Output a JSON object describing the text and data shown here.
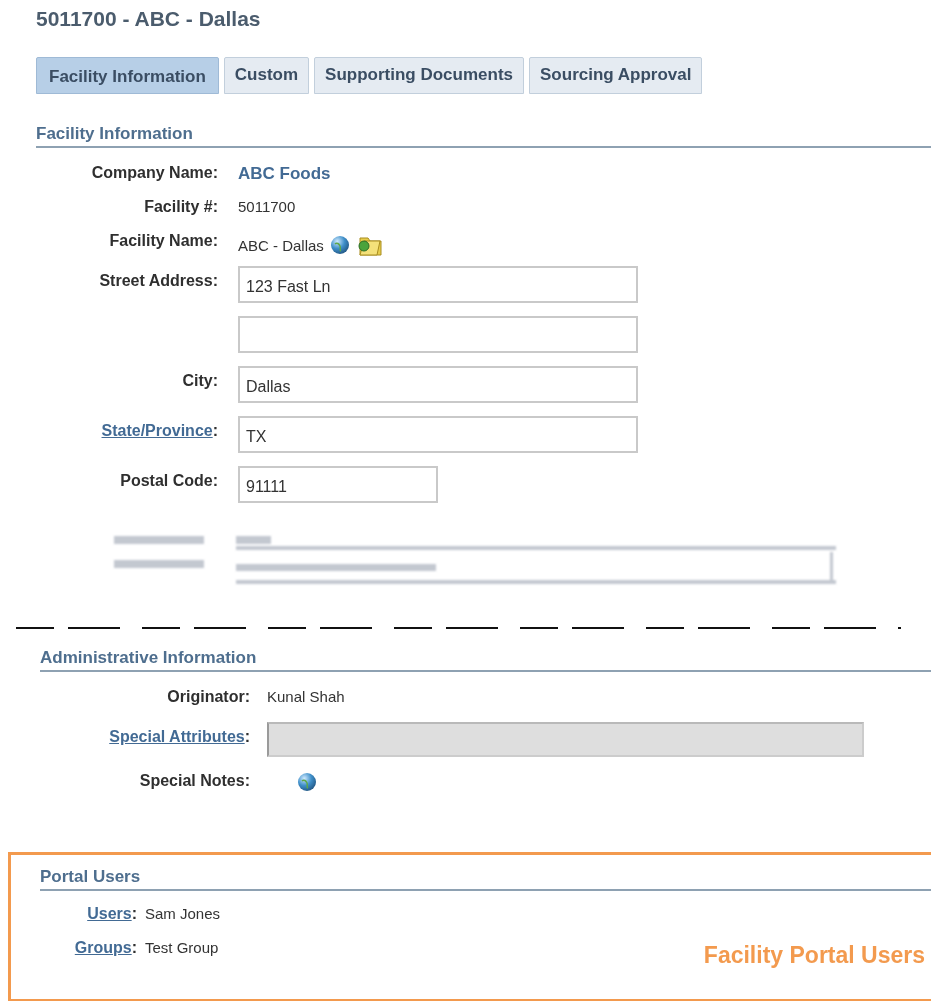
{
  "title": "5011700 - ABC - Dallas",
  "tabs": [
    {
      "label": "Facility Information",
      "selected": true
    },
    {
      "label": "Custom",
      "selected": false
    },
    {
      "label": "Supporting Documents",
      "selected": false
    },
    {
      "label": "Sourcing Approval",
      "selected": false
    }
  ],
  "sections": [
    {
      "heading": "Facility Information",
      "rows": [
        {
          "label": "Company Name:",
          "label_link": false,
          "kind": "link",
          "value": "ABC Foods"
        },
        {
          "label": "Facility #:",
          "label_link": false,
          "kind": "text",
          "value": "5011700"
        },
        {
          "label": "Facility Name:",
          "label_link": false,
          "kind": "text-icons",
          "value": "ABC - Dallas"
        },
        {
          "label": "Street Address:",
          "label_link": false,
          "kind": "field",
          "value": "123 Fast Ln"
        },
        {
          "kind": "field"
        },
        {
          "label": "City:",
          "label_link": false,
          "kind": "field",
          "value": "Dallas"
        },
        {
          "label": "State/Province",
          "suffix": ":",
          "label_link": true,
          "kind": "field",
          "value": "TX"
        },
        {
          "label": "Postal Code:",
          "label_link": false,
          "kind": "field-short",
          "value": "91111"
        },
        {
          "kind": "blurred"
        }
      ]
    },
    {
      "heading": "Administrative Information",
      "rows": [
        {
          "label": "Originator:",
          "label_link": false,
          "kind": "text",
          "value": "Kunal Shah"
        },
        {
          "label": "Special Attributes",
          "suffix": ":",
          "label_link": true,
          "kind": "field-disabled"
        },
        {
          "label": "Special Notes:",
          "label_link": false,
          "kind": "icon"
        }
      ]
    },
    {
      "heading": "Portal Users",
      "highlight": true,
      "rows": [
        {
          "label": "Users",
          "suffix": ":",
          "label_link": true,
          "kind": "text",
          "value": "Sam Jones"
        },
        {
          "label": "Groups",
          "suffix": ":",
          "label_link": true,
          "kind": "text",
          "value": "Test Group"
        }
      ],
      "annotation": "Facility Portal Users"
    }
  ]
}
